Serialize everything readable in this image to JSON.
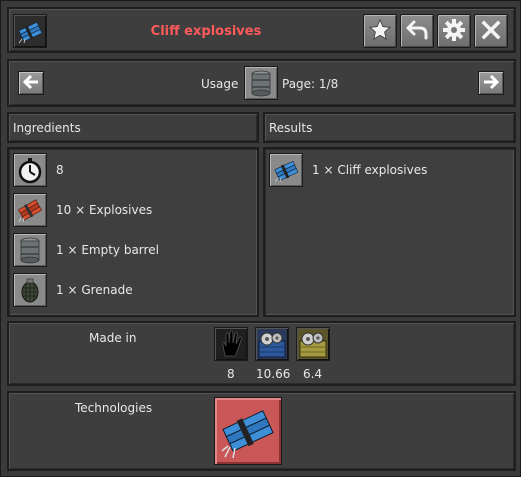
{
  "header": {
    "title": "Cliff explosives",
    "title_color": "#ff5a5a",
    "item_icon": "cliff-explosives-icon",
    "buttons": [
      "star-icon",
      "back-arrow-icon",
      "gear-icon",
      "close-icon"
    ]
  },
  "navigation": {
    "mode_label": "Usage",
    "mode_icon": "empty-barrel-icon",
    "page_label": "Page: 1/8"
  },
  "ingredients": {
    "header": "Ingredients",
    "items": [
      {
        "icon": "time-icon",
        "text": "8"
      },
      {
        "icon": "explosives-icon",
        "text": "10 × Explosives"
      },
      {
        "icon": "empty-barrel-icon",
        "text": "1 × Empty barrel"
      },
      {
        "icon": "grenade-icon",
        "text": "1 × Grenade"
      }
    ]
  },
  "results": {
    "header": "Results",
    "items": [
      {
        "icon": "cliff-explosives-icon",
        "text": "1 × Cliff explosives"
      }
    ]
  },
  "made_in": {
    "label": "Made in",
    "machines": [
      {
        "icon": "hand-icon",
        "value": "8"
      },
      {
        "icon": "assembling-machine-2-icon",
        "value": "10.66"
      },
      {
        "icon": "assembling-machine-1-icon",
        "value": "6.4"
      }
    ]
  },
  "technologies": {
    "label": "Technologies",
    "items": [
      {
        "icon": "cliff-explosives-technology-icon"
      }
    ]
  }
}
